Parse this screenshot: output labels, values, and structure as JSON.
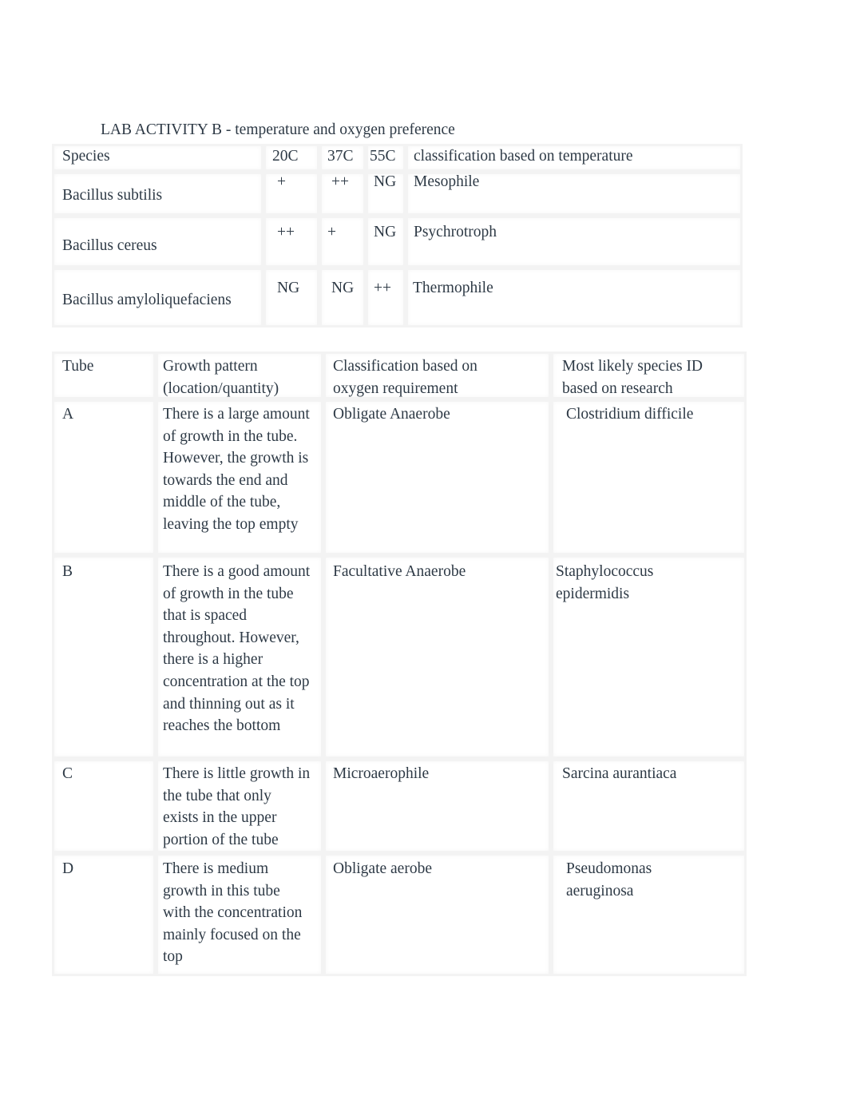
{
  "title": "LAB ACTIVITY B - temperature and oxygen preference",
  "temperature_table": {
    "headers": [
      "Species",
      "20C",
      "37C",
      "55C",
      "classification based on temperature"
    ],
    "rows": [
      [
        "Bacillus subtilis",
        "+",
        "++",
        "NG",
        "Mesophile"
      ],
      [
        "Bacillus cereus",
        "++",
        "+",
        "NG",
        "Psychrotroph"
      ],
      [
        "Bacillus amyloliquefaciens",
        "NG",
        "NG",
        "++",
        "Thermophile"
      ]
    ]
  },
  "oxygen_table": {
    "headers": [
      "Tube",
      "Growth pattern (location/quantity)",
      "Classification based on oxygen requirement",
      "Most likely species ID based on research"
    ],
    "rows": [
      [
        "A",
        "There is a large amount of growth in the tube. However, the growth is towards the end and middle of the tube, leaving the top empty",
        "Obligate Anaerobe",
        "Clostridium difficile"
      ],
      [
        "B",
        "There is a good amount of growth in the tube that is spaced throughout. However, there is a higher concentration at the top and thinning out as it reaches the bottom",
        "Facultative Anaerobe",
        "Staphylococcus epidermidis"
      ],
      [
        "C",
        "There is little growth in the tube that only exists in the upper portion of the tube",
        "Microaerophile",
        "Sarcina aurantiaca"
      ],
      [
        "D",
        "There is medium growth in this tube with the concentration mainly focused on the top",
        "Obligate aerobe",
        "Pseudomonas aeruginosa"
      ]
    ]
  }
}
